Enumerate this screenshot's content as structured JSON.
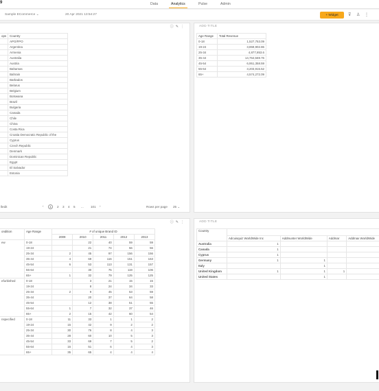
{
  "nav": {
    "logo": "9",
    "tabs": [
      "Data",
      "Analytics",
      "Pulse",
      "Admin"
    ],
    "active": "Analytics"
  },
  "toolbar": {
    "datasource": "Sample ECommerce ⌄",
    "timestamp": "20 Apr 2021 13:54:27",
    "widget_label": "+ Widget"
  },
  "panel_tl": {
    "header": [
      "ops",
      "Country"
    ],
    "countries": [
      "APO/FPO",
      "Argentina",
      "Armenia",
      "Australia",
      "Austria",
      "Bahamas",
      "Bahrain",
      "Barbados",
      "Belarus",
      "Belgium",
      "Botswana",
      "Brazil",
      "Bulgaria",
      "Canada",
      "Chile",
      "China",
      "Costa Rica",
      "Croatia Democratic Republic of the",
      "Cyprus",
      "Czech Republic",
      "Denmark",
      "Dominican Republic",
      "Egypt",
      "El Salvador",
      "Estonia"
    ],
    "pager_left": "lledit",
    "pages": [
      "1",
      "2",
      "3",
      "4",
      "5",
      "...",
      "101"
    ],
    "rows_label": "Rows per page",
    "rows_value": "25 ⌄"
  },
  "panel_tr": {
    "title": "ADD TITLE",
    "headers": [
      "Age Range",
      "Total Revenue"
    ],
    "rows": [
      [
        "0-18",
        "1,527,753.09"
      ],
      [
        "19-24",
        "3,859,902.86"
      ],
      [
        "25-34",
        "4,877,853.6"
      ],
      [
        "35-44",
        "14,764,569.76"
      ],
      [
        "45-54",
        "6,951,358.59"
      ],
      [
        "55-64",
        "3,203,915.52"
      ],
      [
        "65+",
        "4,574,272.09"
      ]
    ]
  },
  "panel_bl": {
    "headers": [
      "ondition",
      "Age Range",
      "# of unique Brand ID"
    ],
    "years": [
      "2009",
      "2010",
      "2011",
      "2012",
      "2013"
    ],
    "groups": [
      {
        "label": "ew",
        "rows": [
          [
            "0-18",
            "",
            "22",
            "40",
            "59",
            "59"
          ],
          [
            "19-24",
            "",
            "21",
            "74",
            "56",
            "56"
          ],
          [
            "25-34",
            "2",
            "45",
            "97",
            "156",
            "156"
          ],
          [
            "35-44",
            "4",
            "69",
            "116",
            "151",
            "163"
          ],
          [
            "45-54",
            "6",
            "53",
            "113",
            "131",
            "157"
          ],
          [
            "55-64",
            "",
            "30",
            "75",
            "119",
            "106"
          ],
          [
            "65+",
            "1",
            "32",
            "79",
            "125",
            "125"
          ]
        ]
      },
      {
        "label": "efurbished",
        "rows": [
          [
            "0-18",
            "",
            "3",
            "21",
            "15",
            "15"
          ],
          [
            "19-24",
            "",
            "8",
            "24",
            "34",
            "33"
          ],
          [
            "25-34",
            "2",
            "9",
            "45",
            "53",
            "59"
          ],
          [
            "35-44",
            "",
            "20",
            "37",
            "64",
            "58"
          ],
          [
            "45-54",
            "",
            "12",
            "38",
            "51",
            "55"
          ],
          [
            "55-64",
            "1",
            "7",
            "32",
            "37",
            "46"
          ],
          [
            "65+",
            "2",
            "15",
            "42",
            "60",
            "54"
          ]
        ]
      },
      {
        "label": "nspecified",
        "rows": [
          [
            "0-18",
            "11",
            "33",
            "1",
            "1",
            "2"
          ],
          [
            "19-24",
            "15",
            "42",
            "9",
            "2",
            "2"
          ],
          [
            "25-34",
            "30",
            "76",
            "8",
            "4",
            "3"
          ],
          [
            "35-44",
            "28",
            "60",
            "10",
            "5",
            "3"
          ],
          [
            "45-54",
            "33",
            "69",
            "7",
            "5",
            "2"
          ],
          [
            "55-64",
            "16",
            "51",
            "6",
            "4",
            "3"
          ],
          [
            "65+",
            "35",
            "65",
            "4",
            "4",
            "4"
          ]
        ]
      }
    ]
  },
  "panel_br": {
    "title": "ADD TITLE",
    "header": "Country",
    "columns": [
      "Adcuisquiz WorldWide Inc",
      "Addmunter WorldWide",
      "Addmar",
      "Addmax WorldWide"
    ],
    "rows": [
      [
        "Australia",
        "1",
        "",
        "",
        ""
      ],
      [
        "Canada",
        "1",
        "",
        "",
        ""
      ],
      [
        "Cyprus",
        "1",
        "",
        "",
        ""
      ],
      [
        "Germany",
        "1",
        "1",
        "",
        ""
      ],
      [
        "Italy",
        "",
        "1",
        "",
        ""
      ],
      [
        "United Kingdom",
        "1",
        "1",
        "1",
        ""
      ],
      [
        "United States",
        "",
        "1",
        "",
        ""
      ]
    ]
  }
}
